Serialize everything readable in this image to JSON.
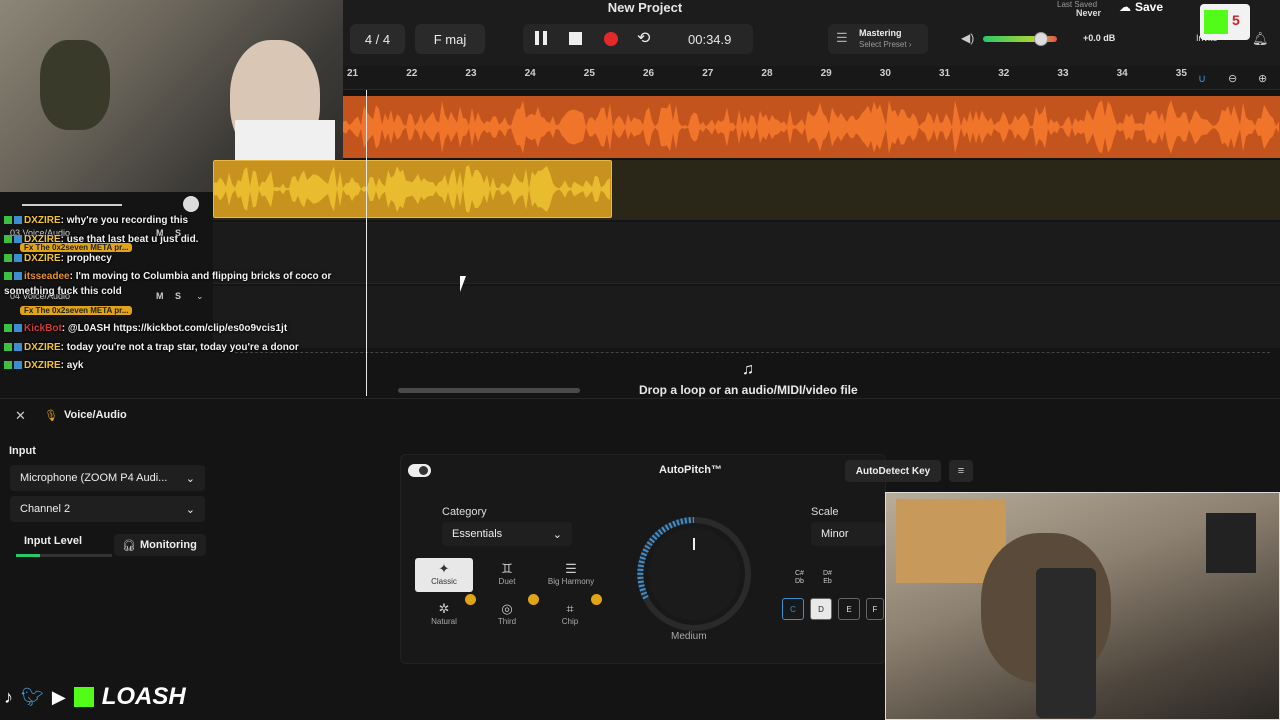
{
  "app": {
    "project_title": "New Project",
    "last_saved_label": "Last Saved",
    "last_saved_value": "Never",
    "save_label": "Save"
  },
  "toolbar": {
    "time_signature": "4 / 4",
    "key": "F maj",
    "time": "00:34.9",
    "mastering_label": "Mastering",
    "mastering_preset": "Select Preset ›",
    "volume_db": "+0.0 dB",
    "volume_level": 0.78,
    "invite_label": "Invite"
  },
  "ruler": {
    "ticks": [
      "21",
      "22",
      "23",
      "24",
      "25",
      "26",
      "27",
      "28",
      "29",
      "30",
      "31",
      "32",
      "33",
      "34",
      "35"
    ]
  },
  "tracks": [
    {
      "name": "03  Voice/Audio",
      "m": "M",
      "s": "S"
    },
    {
      "name": "04  Voice/Audio",
      "m": "M",
      "s": "S"
    }
  ],
  "dropzone": {
    "text": "Drop a loop or an audio/MIDI/video file"
  },
  "chat": [
    {
      "user": "DXZIRE",
      "msg": ": why're you recording this"
    },
    {
      "user": "DXZIRE",
      "msg": ": use that last beat u just did."
    },
    {
      "user": "",
      "msg": "Fx The 0x2seven META pr..."
    },
    {
      "user": "DXZIRE",
      "msg": ": prophecy"
    },
    {
      "user": "itsseadee",
      "msg": ": I'm moving to Columbia and flipping bricks of coco or"
    },
    {
      "user": "",
      "msg": "something fuck this cold"
    },
    {
      "user": "",
      "msg": "Fx The 0x2seven META pr..."
    },
    {
      "user": "KickBot",
      "msg": ": @L0ASH https://kickbot.com/clip/es0o9vcis1jt"
    },
    {
      "user": "DXZIRE",
      "msg": ": today you're not a trap star, today you're a donor"
    },
    {
      "user": "DXZIRE",
      "msg": ": ayk"
    }
  ],
  "lower": {
    "section_title": "Voice/Audio",
    "input_label": "Input",
    "input_device": "Microphone (ZOOM P4 Audi...",
    "channel": "Channel 2",
    "input_level_label": "Input Level",
    "input_level": 0.25,
    "monitoring_label": "Monitoring"
  },
  "autopitch": {
    "title": "AutoPitch™",
    "autodetect_label": "AutoDetect Key",
    "category_label": "Category",
    "category_value": "Essentials",
    "modes": [
      {
        "label": "Classic",
        "icon": "sparkle-icon"
      },
      {
        "label": "Duet",
        "icon": "duet-icon"
      },
      {
        "label": "Big Harmony",
        "icon": "harmony-icon"
      },
      {
        "label": "Natural",
        "icon": "natural-icon"
      },
      {
        "label": "Third",
        "icon": "third-icon"
      },
      {
        "label": "Chip",
        "icon": "chip-icon"
      }
    ],
    "knob_label": "Medium",
    "scale_label": "Scale",
    "scale_value": "Minor",
    "accidentals": [
      "C#\nDb",
      "D#\nEb"
    ],
    "keys": [
      "C",
      "D",
      "E",
      "F"
    ]
  },
  "branding": {
    "kick_channel": "LOASH",
    "kick_count": "5"
  }
}
